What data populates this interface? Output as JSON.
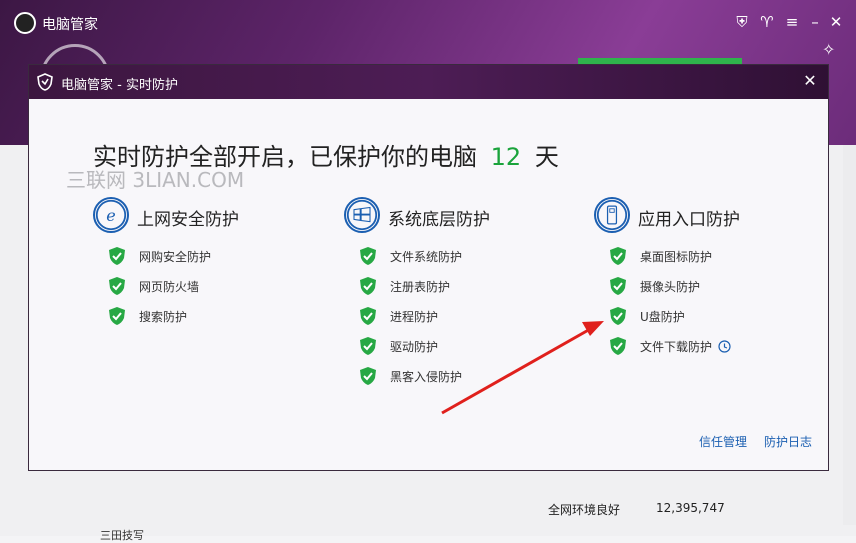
{
  "background": {
    "app_title": "电脑管家",
    "status_left": "全网环境良好",
    "status_count": "12,395,747",
    "bottom_text": "三田技写"
  },
  "dialog": {
    "title": "电脑管家 - 实时防护",
    "close": "✕",
    "headline_prefix": "实时防护全部开启，已保护你的电脑",
    "days": "12",
    "headline_suffix": "天",
    "watermark": "三联网 3LIAN.COM",
    "columns": [
      {
        "title": "上网安全防护",
        "icon": "ie-icon",
        "items": [
          "网购安全防护",
          "网页防火墙",
          "搜索防护"
        ]
      },
      {
        "title": "系统底层防护",
        "icon": "windows-icon",
        "items": [
          "文件系统防护",
          "注册表防护",
          "进程防护",
          "驱动防护",
          "黑客入侵防护"
        ]
      },
      {
        "title": "应用入口防护",
        "icon": "usb-icon",
        "items": [
          "桌面图标防护",
          "摄像头防护",
          "U盘防护",
          "文件下载防护"
        ]
      }
    ],
    "links": {
      "trust": "信任管理",
      "log": "防护日志"
    }
  },
  "colors": {
    "accent_green": "#1aa33b",
    "link_blue": "#1b5fb1",
    "title_purple": "#4d1d55",
    "arrow_red": "#e0201c"
  }
}
